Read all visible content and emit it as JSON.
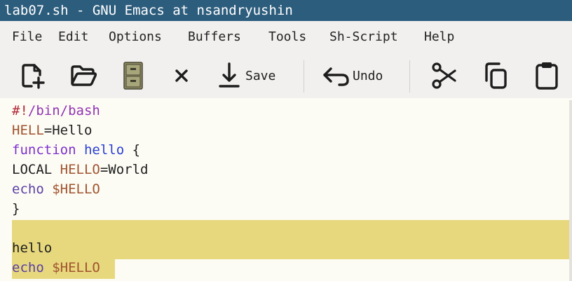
{
  "window": {
    "title": "lab07.sh - GNU Emacs at nsandryushin"
  },
  "menu": {
    "items": [
      "File",
      "Edit",
      "Options",
      "Buffers",
      "Tools",
      "Sh-Script",
      "Help"
    ]
  },
  "toolbar": {
    "save_label": "Save",
    "undo_label": "Undo",
    "icons": [
      "new-file-icon",
      "open-folder-icon",
      "file-cabinet-icon",
      "close-icon",
      "save-icon",
      "undo-icon",
      "cut-icon",
      "copy-icon",
      "paste-icon"
    ]
  },
  "editor": {
    "lines": [
      {
        "parts": [
          "#!",
          "/bin/bash"
        ]
      },
      {
        "parts": [
          "HELL",
          "=Hello"
        ]
      },
      {
        "parts": [
          "function",
          " ",
          "hello",
          " {"
        ]
      },
      {
        "parts": [
          "LOCAL ",
          "HELLO",
          "=World"
        ]
      },
      {
        "parts": [
          "echo",
          " ",
          "$HELLO"
        ]
      },
      {
        "parts": [
          "}"
        ]
      },
      {
        "parts": [
          ""
        ]
      },
      {
        "parts": [
          "hello"
        ]
      },
      {
        "parts": [
          "echo",
          " ",
          "$HELLO"
        ]
      }
    ],
    "highlight_color": "#e7d87e"
  },
  "colors": {
    "titlebar_bg": "#2d5d7d",
    "chrome_bg": "#f1f0ee",
    "editor_bg": "#fdfcf4",
    "variable": "#a0522d",
    "keyword": "#7d2fd0",
    "function_name": "#2a3fd6",
    "comment": "#b12a3a",
    "shebang_path": "#9233b5",
    "builtin": "#5a3fa6"
  }
}
